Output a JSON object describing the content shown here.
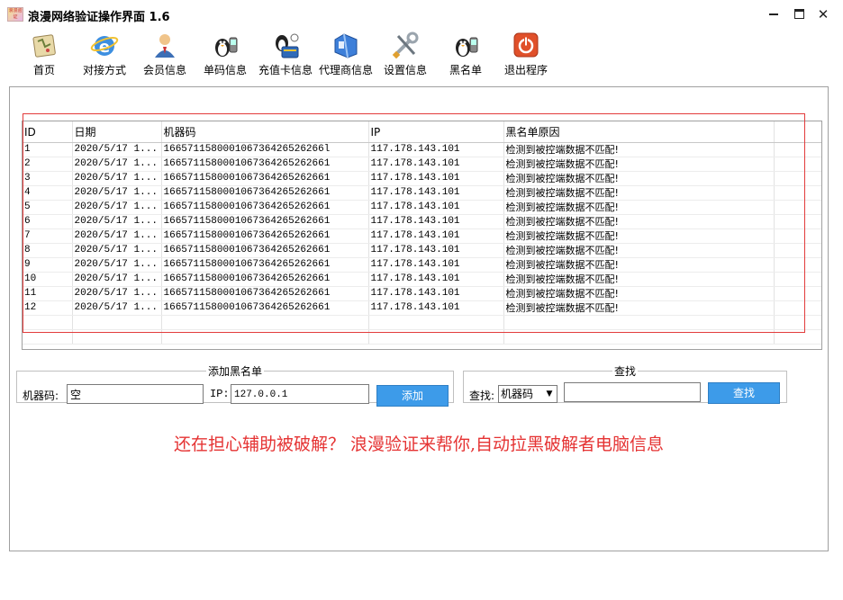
{
  "window": {
    "title": "浪漫网络验证操作界面 1.6",
    "app_icon_text": "浪漫验证",
    "close_glyph": "✕"
  },
  "toolbar": [
    {
      "label": "首页",
      "icon": "home-map-icon"
    },
    {
      "label": "对接方式",
      "icon": "ie-browser-icon"
    },
    {
      "label": "会员信息",
      "icon": "member-user-icon"
    },
    {
      "label": "单码信息",
      "icon": "penguin-phone-icon"
    },
    {
      "label": "充值卡信息",
      "icon": "recharge-card-icon"
    },
    {
      "label": "代理商信息",
      "icon": "agent-folder-icon"
    },
    {
      "label": "设置信息",
      "icon": "settings-tools-icon"
    },
    {
      "label": "黑名单",
      "icon": "blacklist-penguin-icon"
    },
    {
      "label": "退出程序",
      "icon": "exit-power-icon"
    }
  ],
  "table": {
    "columns": [
      "ID",
      "日期",
      "机器码",
      "IP",
      "黑名单原因"
    ],
    "rows": [
      {
        "id": "1",
        "date": "2020/5/17 1...",
        "machine": "166571158000106736426526266l",
        "ip": "117.178.143.101",
        "reason": "检测到被控端数据不匹配!"
      },
      {
        "id": "2",
        "date": "2020/5/17 1...",
        "machine": "1665711580001067364265262661",
        "ip": "117.178.143.101",
        "reason": "检测到被控端数据不匹配!"
      },
      {
        "id": "3",
        "date": "2020/5/17 1...",
        "machine": "1665711580001067364265262661",
        "ip": "117.178.143.101",
        "reason": "检测到被控端数据不匹配!"
      },
      {
        "id": "4",
        "date": "2020/5/17 1...",
        "machine": "1665711580001067364265262661",
        "ip": "117.178.143.101",
        "reason": "检测到被控端数据不匹配!"
      },
      {
        "id": "5",
        "date": "2020/5/17 1...",
        "machine": "1665711580001067364265262661",
        "ip": "117.178.143.101",
        "reason": "检测到被控端数据不匹配!"
      },
      {
        "id": "6",
        "date": "2020/5/17 1...",
        "machine": "1665711580001067364265262661",
        "ip": "117.178.143.101",
        "reason": "检测到被控端数据不匹配!"
      },
      {
        "id": "7",
        "date": "2020/5/17 1...",
        "machine": "1665711580001067364265262661",
        "ip": "117.178.143.101",
        "reason": "检测到被控端数据不匹配!"
      },
      {
        "id": "8",
        "date": "2020/5/17 1...",
        "machine": "1665711580001067364265262661",
        "ip": "117.178.143.101",
        "reason": "检测到被控端数据不匹配!"
      },
      {
        "id": "9",
        "date": "2020/5/17 1...",
        "machine": "1665711580001067364265262661",
        "ip": "117.178.143.101",
        "reason": "检测到被控端数据不匹配!"
      },
      {
        "id": "10",
        "date": "2020/5/17 1...",
        "machine": "1665711580001067364265262661",
        "ip": "117.178.143.101",
        "reason": "检测到被控端数据不匹配!"
      },
      {
        "id": "11",
        "date": "2020/5/17 1...",
        "machine": "1665711580001067364265262661",
        "ip": "117.178.143.101",
        "reason": "检测到被控端数据不匹配!"
      },
      {
        "id": "12",
        "date": "2020/5/17 1...",
        "machine": "1665711580001067364265262661",
        "ip": "117.178.143.101",
        "reason": "检测到被控端数据不匹配!"
      }
    ]
  },
  "add_panel": {
    "legend": "添加黑名单",
    "machine_label": "机器码:",
    "machine_value": "空",
    "ip_label": "IP:",
    "ip_value": "127.0.0.1",
    "add_button": "添加"
  },
  "find_panel": {
    "legend": "查找",
    "find_label": "查找:",
    "select_value": "机器码",
    "search_value": "",
    "find_button": "查找"
  },
  "slogan": "还在担心辅助被破解？ 浪漫验证来帮你,自动拉黑破解者电脑信息",
  "colors": {
    "accent_button": "#3d9be9",
    "slogan": "#e53333",
    "highlight_box": "#e23b3b"
  }
}
